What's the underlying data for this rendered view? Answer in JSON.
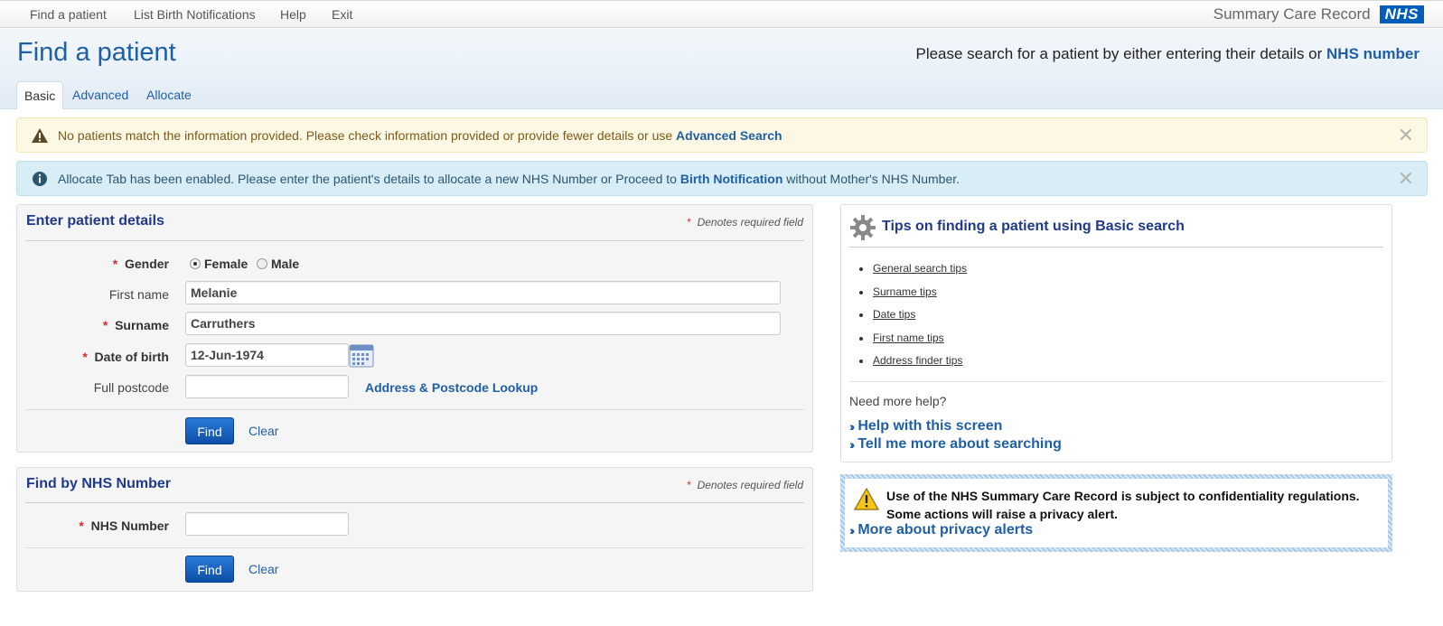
{
  "nav": {
    "items": [
      "Find a patient",
      "List Birth Notifications",
      "Help",
      "Exit"
    ],
    "brand_text": "Summary Care Record",
    "logo_text": "NHS"
  },
  "header": {
    "title": "Find a patient",
    "hint_prefix": "Please search for a patient by either entering their details or ",
    "hint_link": "NHS number",
    "tabs": [
      "Basic",
      "Advanced",
      "Allocate"
    ],
    "active_tab": "Basic"
  },
  "alerts": {
    "warning": {
      "text": "No patients match the information provided. Please check information provided or provide fewer details or use ",
      "link": "Advanced Search"
    },
    "info": {
      "text_before": "Allocate Tab has been enabled. Please enter the patient's details to allocate a new NHS Number or Proceed to ",
      "link": "Birth Notification",
      "text_after": " without Mother's NHS Number."
    },
    "close_glyph": "✕"
  },
  "patient_form": {
    "title": "Enter patient details",
    "required_note": "Denotes required field",
    "required_mark": "*",
    "gender_label": "Gender",
    "gender_options": [
      "Female",
      "Male"
    ],
    "gender_selected": "Female",
    "first_name_label": "First name",
    "first_name_value": "Melanie",
    "surname_label": "Surname",
    "surname_value": "Carruthers",
    "dob_label": "Date of birth",
    "dob_value": "12-Jun-1974",
    "postcode_label": "Full postcode",
    "postcode_value": "",
    "lookup_link": "Address & Postcode Lookup",
    "find_label": "Find",
    "clear_label": "Clear"
  },
  "nhs_form": {
    "title": "Find by NHS Number",
    "required_note": "Denotes required field",
    "nhs_number_label": "NHS Number",
    "nhs_number_value": "",
    "find_label": "Find",
    "clear_label": "Clear"
  },
  "tips": {
    "title": "Tips on finding a patient using Basic search",
    "items": [
      "General search tips",
      "Surname tips",
      "Date tips",
      "First name tips",
      "Address finder tips"
    ],
    "need_help": "Need more help?",
    "help_links": [
      "Help with this screen",
      "Tell me more about searching"
    ]
  },
  "privacy": {
    "line1": "Use of the NHS Summary Care Record is subject to confidentiality regulations.",
    "line2": "Some actions will raise a privacy alert.",
    "link": "More about privacy alerts"
  },
  "colors": {
    "link": "#1f5fa6",
    "heading": "#1f3a8a",
    "required": "#c9302c",
    "button": "#0d4fa8",
    "warning_bg": "#fcf8e3",
    "info_bg": "#d9edf7"
  }
}
